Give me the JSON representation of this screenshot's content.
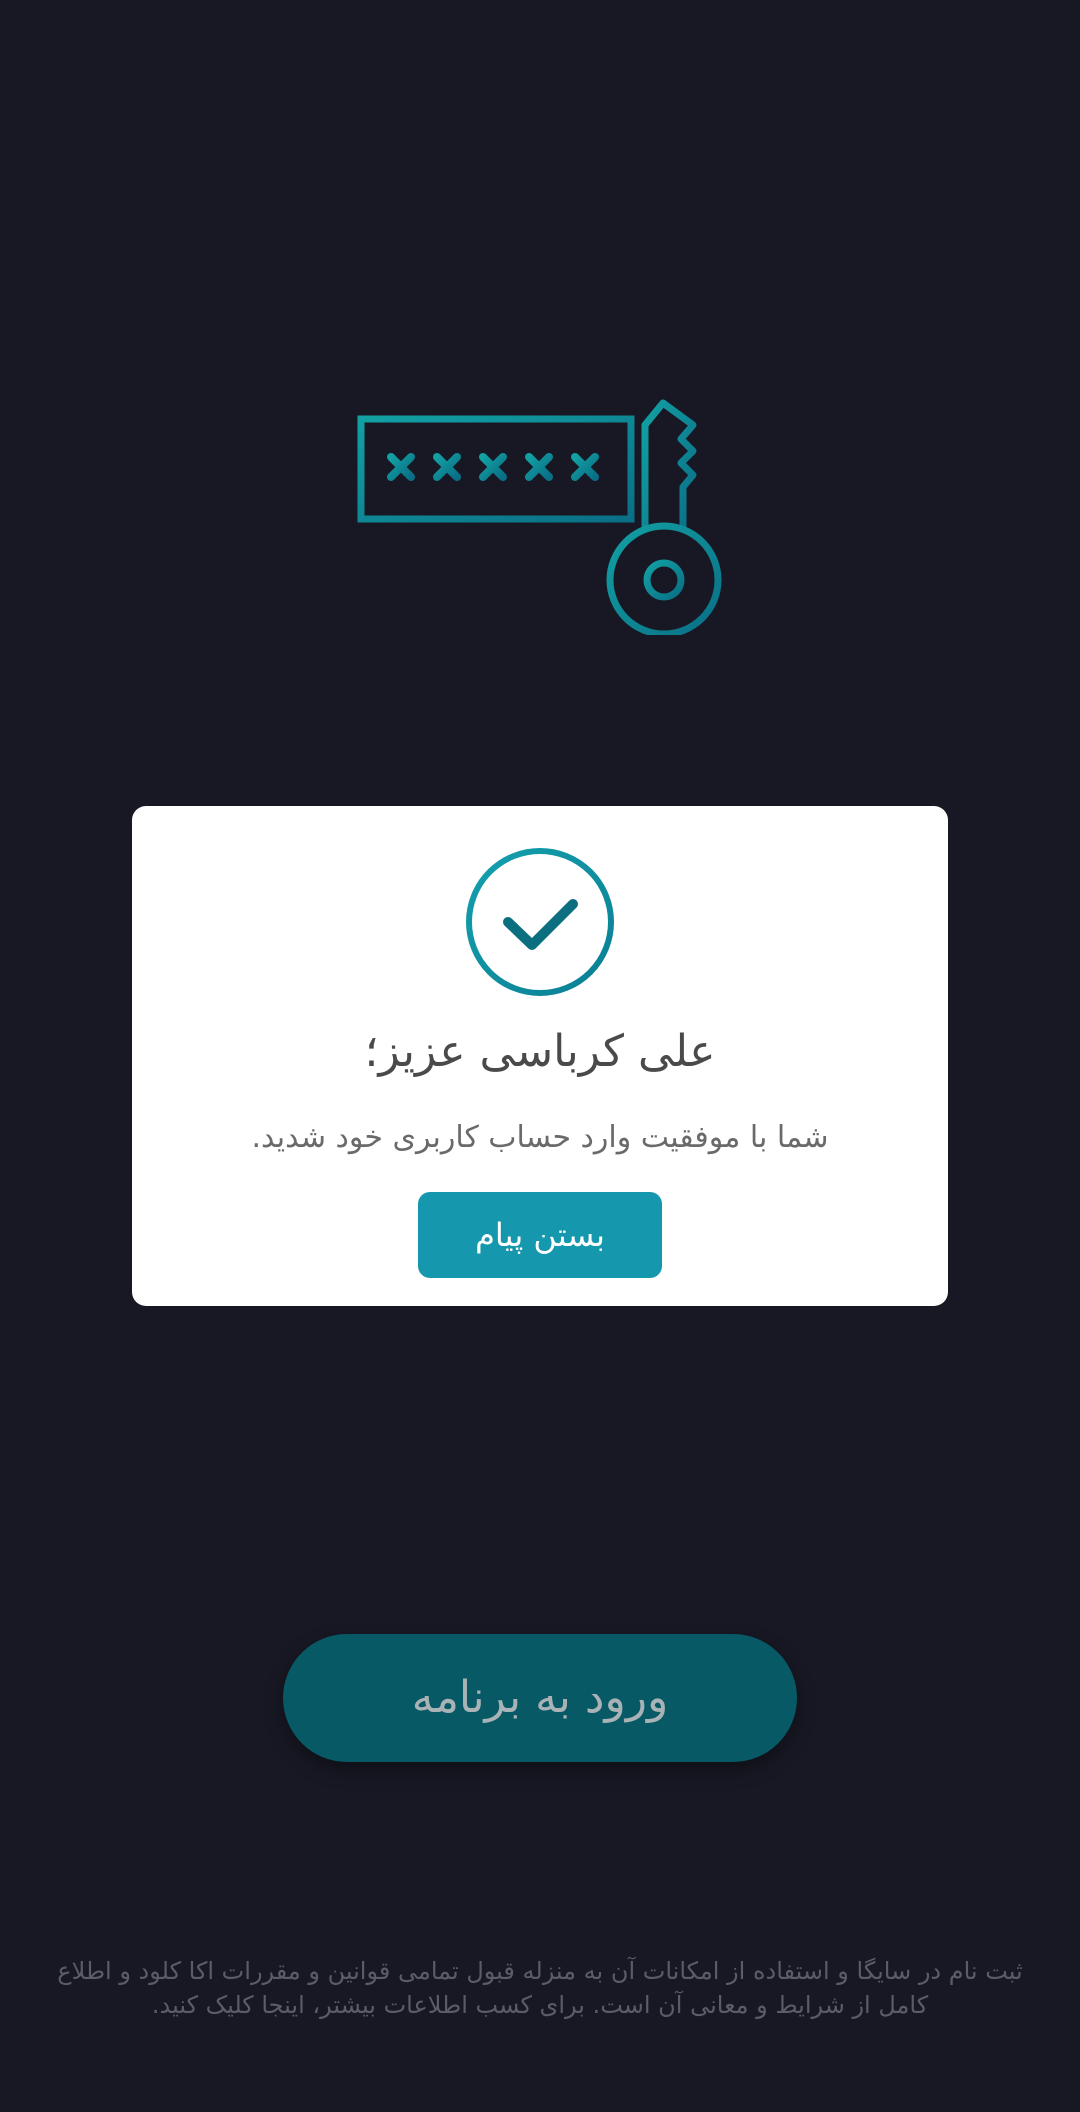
{
  "hero": {
    "icon": "password-key-icon",
    "accent_color": "#0f8d98"
  },
  "dialog": {
    "icon": "check-circle-icon",
    "title": "علی کرباسی عزیز؛",
    "message": "شما با موفقیت وارد حساب کاربری خود شدید.",
    "close_label": "بستن پیام",
    "button_color": "#1597ae"
  },
  "login": {
    "label": "ورود به برنامه",
    "color": "#075965"
  },
  "footer": {
    "text": "ثبت نام در سایگا و استفاده از امکانات آن به منزله قبول تمامی قوانین و مقررات اکا کلود و اطلاع کامل از شرایط و معانی آن است. برای کسب اطلاعات بیشتر، اینجا کلیک کنید."
  }
}
